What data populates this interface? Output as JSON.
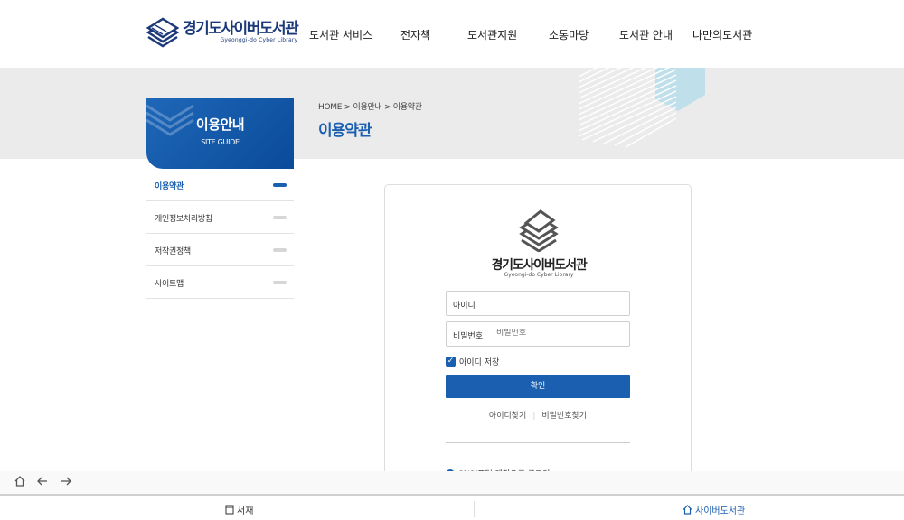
{
  "header": {
    "logo_kr": "경기도사이버도서관",
    "logo_en": "Gyeonggi-do Cyber Library",
    "nav": [
      {
        "label": "도서관 서비스"
      },
      {
        "label": "전자책"
      },
      {
        "label": "도서관지원"
      },
      {
        "label": "소통마당"
      },
      {
        "label": "도서관 안내"
      },
      {
        "label": "나만의도서관"
      }
    ]
  },
  "banner": {
    "breadcrumb": "HOME > 이용안내 > 이용약관",
    "title": "이용약관"
  },
  "sidebar": {
    "title": "이용안내",
    "subtitle": "SITE GUIDE",
    "items": [
      {
        "label": "이용약관",
        "active": true
      },
      {
        "label": "개인정보처리방침",
        "active": false
      },
      {
        "label": "저작권정책",
        "active": false
      },
      {
        "label": "사이트맵",
        "active": false
      }
    ]
  },
  "login": {
    "logo_kr": "경기도사이버도서관",
    "logo_en": "Gyeongi-do Cyber Library",
    "id_label": "아이디",
    "id_value": "",
    "pw_label": "비밀번호",
    "pw_placeholder": "비밀번호",
    "remember_label": "아이디 저장",
    "remember_checked": true,
    "submit_label": "확인",
    "find_id": "아이디찾기",
    "find_pw": "비밀번호찾기",
    "sns_label": "SNS/포털 계정으로 로그인"
  },
  "browser": {
    "tabs": [
      {
        "label": "서재",
        "icon": "book-icon"
      },
      {
        "label": "사이버도서관",
        "icon": "home-icon",
        "active": true
      }
    ]
  },
  "colors": {
    "brand_blue": "#1b5fb0",
    "navy": "#1c3a7a",
    "banner_gray": "#ebebeb"
  }
}
